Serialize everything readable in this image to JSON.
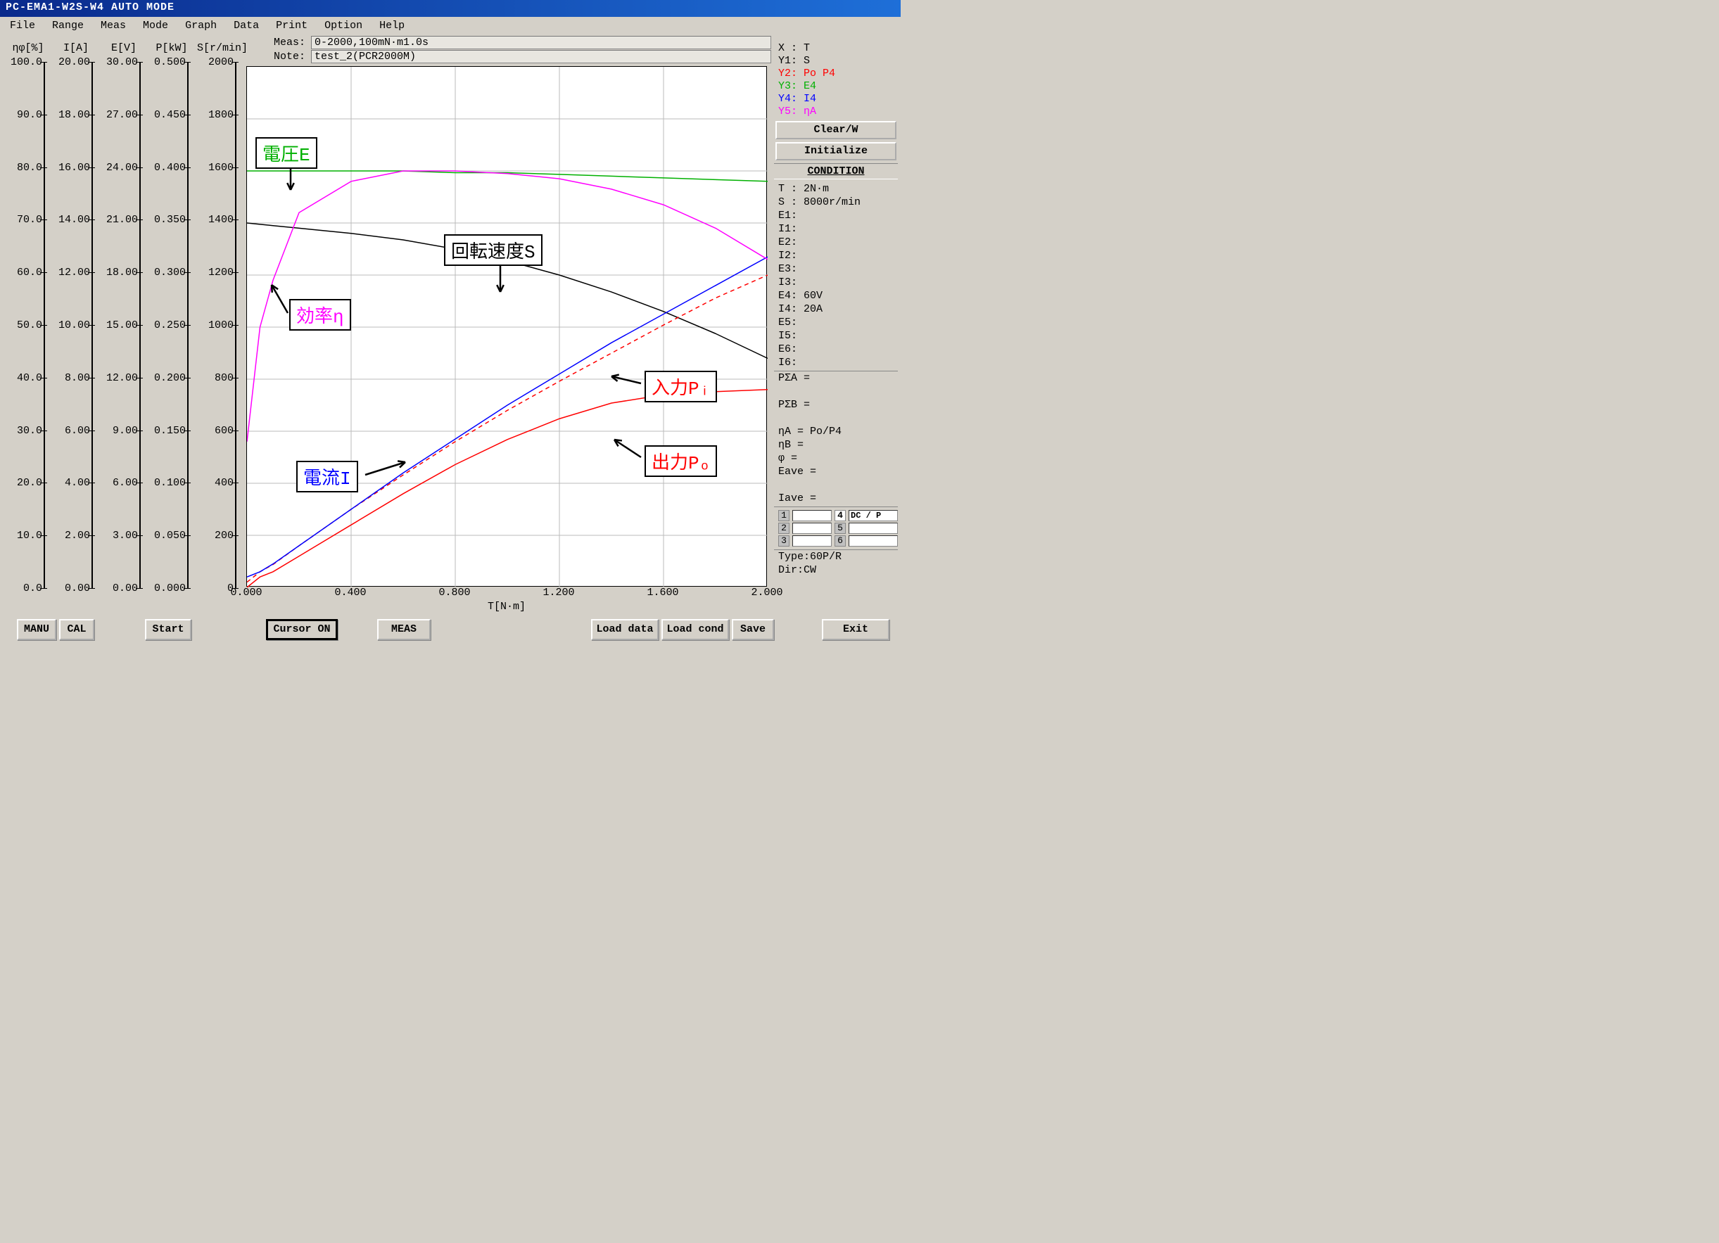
{
  "window_title": "PC-EMA1-W2S-W4 AUTO MODE",
  "menu": [
    "File",
    "Range",
    "Meas",
    "Mode",
    "Graph",
    "Data",
    "Print",
    "Option",
    "Help"
  ],
  "meta": {
    "meas_label": "Meas:",
    "meas_value": "0-2000,100mN·m1.0s",
    "note_label": "Note:",
    "note_value": "test_2(PCR2000M)"
  },
  "yaxes": [
    {
      "header": "ηφ[%]",
      "ticks": [
        "100.0",
        "90.0",
        "80.0",
        "70.0",
        "60.0",
        "50.0",
        "40.0",
        "30.0",
        "20.0",
        "10.0",
        "0.0"
      ]
    },
    {
      "header": "I[A]",
      "ticks": [
        "20.00",
        "18.00",
        "16.00",
        "14.00",
        "12.00",
        "10.00",
        "8.00",
        "6.00",
        "4.00",
        "2.00",
        "0.00"
      ]
    },
    {
      "header": "E[V]",
      "ticks": [
        "30.00",
        "27.00",
        "24.00",
        "21.00",
        "18.00",
        "15.00",
        "12.00",
        "9.00",
        "6.00",
        "3.00",
        "0.00"
      ]
    },
    {
      "header": "P[kW]",
      "ticks": [
        "0.500",
        "0.450",
        "0.400",
        "0.350",
        "0.300",
        "0.250",
        "0.200",
        "0.150",
        "0.100",
        "0.050",
        "0.000"
      ]
    },
    {
      "header": "S[r/min]",
      "ticks": [
        "2000",
        "1800",
        "1600",
        "1400",
        "1200",
        "1000",
        "800",
        "600",
        "400",
        "200",
        "0"
      ]
    }
  ],
  "xaxis": {
    "label": "T[N·m]",
    "ticks": [
      "0.000",
      "0.400",
      "0.800",
      "1.200",
      "1.600",
      "2.000"
    ]
  },
  "legend": {
    "x": "X :  T",
    "y1": "Y1:  S",
    "y2": "Y2:  Po P4",
    "y3": "Y3:  E4",
    "y4": "Y4:  I4",
    "y5": "Y5:  ηA"
  },
  "buttons": {
    "clear": "Clear/W",
    "init": "Initialize"
  },
  "condition_header": "CONDITION",
  "condition": [
    "T :  2N·m",
    "S :  8000r/min",
    "E1:",
    "I1:",
    "E2:",
    "I2:",
    "E3:",
    "I3:",
    "E4:   60V",
    "I4:   20A",
    "E5:",
    "I5:",
    "E6:",
    "I6:"
  ],
  "sums": [
    "PΣA =",
    "",
    "PΣB =",
    "",
    "ηA  = Po/P4",
    "ηB  =",
    "φ  =",
    "Eave =",
    "",
    "Iave ="
  ],
  "channels": {
    "1": "",
    "2": "",
    "3": "",
    "4": "DC / P",
    "5": "",
    "6": ""
  },
  "typeinfo": [
    "Type:60P/R",
    "Dir:CW"
  ],
  "bottom": {
    "manu": "MANU",
    "cal": "CAL",
    "start": "Start",
    "cursor": "Cursor ON",
    "meas": "MEAS",
    "load_data": "Load data",
    "load_cond": "Load cond",
    "save": "Save",
    "exit": "Exit"
  },
  "annotations": {
    "voltage": "電圧E",
    "speed": "回転速度S",
    "efficiency": "効率η",
    "current": "電流I",
    "input": "入力Pᵢ",
    "output": "出力Pₒ"
  },
  "colors": {
    "y1": "#000000",
    "y2": "#ff0000",
    "y3": "#00b000",
    "y4": "#0000ff",
    "y5": "#ff00ff"
  },
  "chart_data": {
    "type": "line",
    "title": "Motor characteristics vs torque",
    "xlabel": "T [N·m]",
    "xlim": [
      0,
      2.0
    ],
    "x": [
      0.0,
      0.05,
      0.1,
      0.2,
      0.4,
      0.6,
      0.8,
      1.0,
      1.2,
      1.4,
      1.6,
      1.8,
      2.0
    ],
    "series": [
      {
        "name": "S (speed) [r/min]",
        "axis": "S[r/min]",
        "ylim": [
          0,
          2000
        ],
        "color": "#000000",
        "values": [
          1400,
          1395,
          1390,
          1380,
          1360,
          1335,
          1300,
          1255,
          1200,
          1135,
          1060,
          975,
          880
        ]
      },
      {
        "name": "Po (output) [kW]",
        "axis": "P[kW]",
        "ylim": [
          0,
          0.5
        ],
        "color": "#ff0000",
        "style": "solid",
        "values": [
          0.0,
          0.01,
          0.015,
          0.03,
          0.06,
          0.09,
          0.118,
          0.142,
          0.162,
          0.177,
          0.185,
          0.188,
          0.19
        ]
      },
      {
        "name": "P4 / Pi (input) [kW]",
        "axis": "P[kW]",
        "ylim": [
          0,
          0.5
        ],
        "color": "#ff0000",
        "style": "dashed",
        "values": [
          0.005,
          0.015,
          0.022,
          0.04,
          0.075,
          0.108,
          0.14,
          0.17,
          0.198,
          0.225,
          0.252,
          0.278,
          0.3
        ]
      },
      {
        "name": "E4 (voltage) [V]",
        "axis": "E[V]",
        "ylim": [
          0,
          30
        ],
        "color": "#00b000",
        "values": [
          24.0,
          24.0,
          24.0,
          24.0,
          24.0,
          24.0,
          23.9,
          23.9,
          23.8,
          23.7,
          23.6,
          23.5,
          23.4
        ]
      },
      {
        "name": "I4 (current) [A]",
        "axis": "I[A]",
        "ylim": [
          0,
          20
        ],
        "color": "#0000ff",
        "values": [
          0.4,
          0.6,
          0.9,
          1.6,
          3.0,
          4.4,
          5.7,
          7.0,
          8.2,
          9.4,
          10.5,
          11.6,
          12.7
        ]
      },
      {
        "name": "ηA (efficiency) [%]",
        "axis": "ηφ[%]",
        "ylim": [
          0,
          100
        ],
        "color": "#ff00ff",
        "values": [
          28,
          50,
          59,
          72,
          78,
          80,
          80,
          79.5,
          78.5,
          76.5,
          73.5,
          69,
          63
        ]
      }
    ]
  }
}
